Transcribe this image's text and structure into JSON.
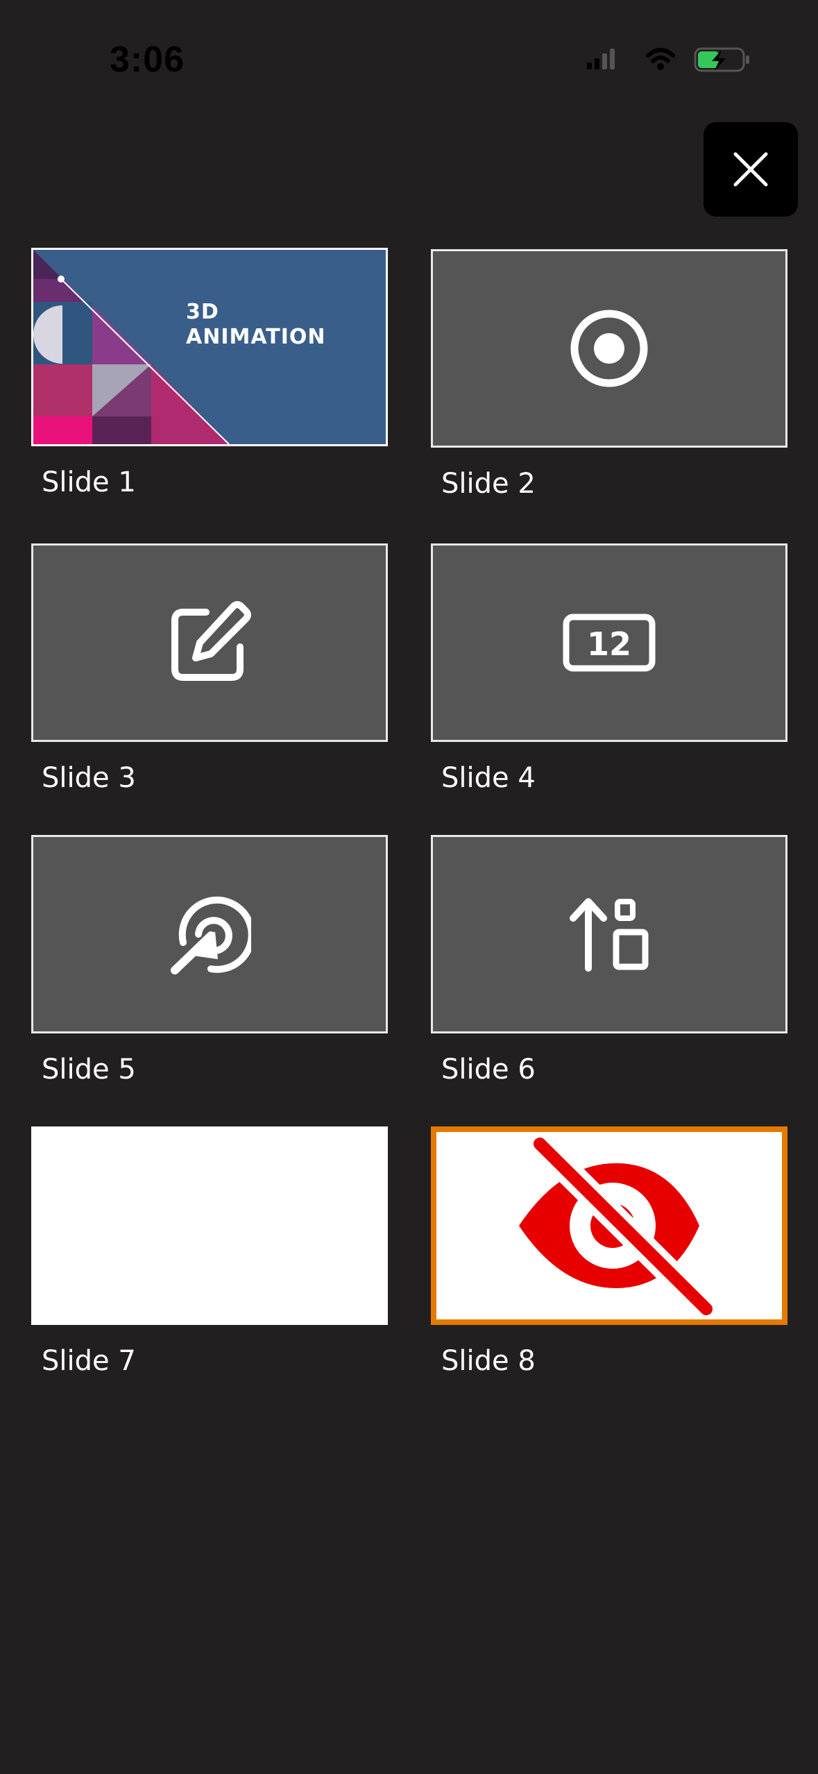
{
  "status_bar": {
    "time": "3:06",
    "icons": [
      "cellular-signal-icon",
      "wifi-icon",
      "battery-charging-icon"
    ],
    "battery_color": "#34c759"
  },
  "close_button": {
    "icon": "close-icon"
  },
  "slides": [
    {
      "label": "Slide 1",
      "thumbnail": "cover",
      "title": "3D ANIMATION"
    },
    {
      "label": "Slide 2",
      "thumbnail": "record-icon"
    },
    {
      "label": "Slide 3",
      "thumbnail": "edit-icon"
    },
    {
      "label": "Slide 4",
      "thumbnail": "number-box-icon",
      "number": "12"
    },
    {
      "label": "Slide 5",
      "thumbnail": "target-arrow-icon"
    },
    {
      "label": "Slide 6",
      "thumbnail": "sort-ascending-icon"
    },
    {
      "label": "Slide 7",
      "thumbnail": "blank"
    },
    {
      "label": "Slide 8",
      "thumbnail": "hidden-eye-icon",
      "selected": true
    }
  ],
  "colors": {
    "background": "#221f20",
    "thumbnail_gray": "#555555",
    "selected_border": "#e57a00",
    "hidden_icon": "#e60000",
    "cover_blue": "#3a5e8a"
  }
}
